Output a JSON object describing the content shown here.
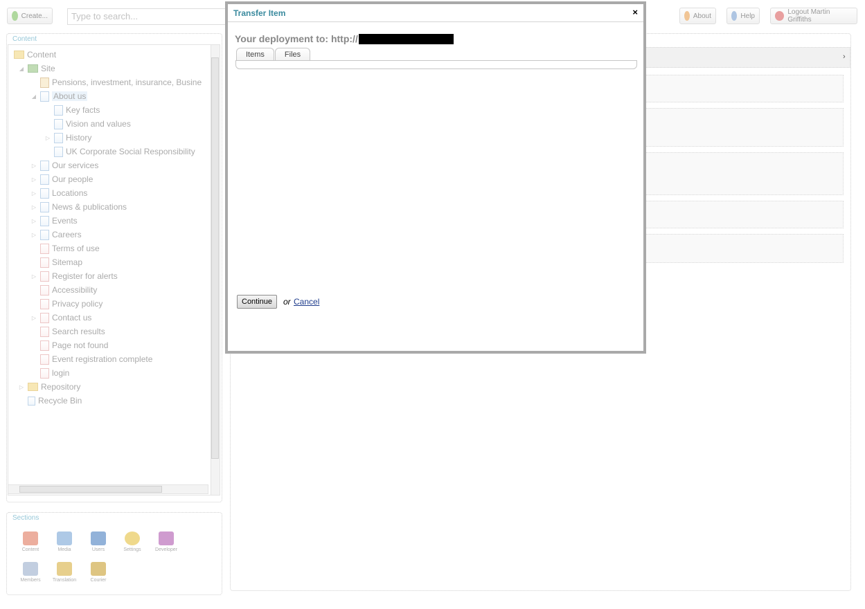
{
  "topbar": {
    "create_label": "Create...",
    "search_placeholder": "Type to search...",
    "about_label": "About",
    "help_label": "Help",
    "logout_label": "Logout  Martin Griffiths"
  },
  "content_panel": {
    "title": "Content",
    "tree": [
      {
        "label": "Content"
      },
      {
        "label": "Site"
      },
      {
        "label": "Pensions, investment, insurance, Busine"
      },
      {
        "label": "About us"
      },
      {
        "label": "Key facts"
      },
      {
        "label": "Vision and values"
      },
      {
        "label": "History"
      },
      {
        "label": "UK Corporate Social Responsibility"
      },
      {
        "label": "Our services"
      },
      {
        "label": "Our people"
      },
      {
        "label": "Locations"
      },
      {
        "label": "News & publications"
      },
      {
        "label": "Events"
      },
      {
        "label": "Careers"
      },
      {
        "label": "Terms of use"
      },
      {
        "label": "Sitemap"
      },
      {
        "label": "Register for alerts"
      },
      {
        "label": "Accessibility"
      },
      {
        "label": "Privacy policy"
      },
      {
        "label": "Contact us"
      },
      {
        "label": "Search results"
      },
      {
        "label": "Page not found"
      },
      {
        "label": "Event registration complete"
      },
      {
        "label": "login"
      },
      {
        "label": "Repository"
      },
      {
        "label": "Recycle Bin"
      }
    ]
  },
  "sections_panel": {
    "title": "Sections",
    "items": [
      {
        "label": "Content",
        "color": "#e07a5f"
      },
      {
        "label": "Media",
        "color": "#7aa6d6"
      },
      {
        "label": "Users",
        "color": "#4a7fc0"
      },
      {
        "label": "Settings",
        "color": "#e6c040"
      },
      {
        "label": "Developer",
        "color": "#b05ab0"
      },
      {
        "label": "Members",
        "color": "#9aaecc"
      },
      {
        "label": "Translation",
        "color": "#d8b040"
      },
      {
        "label": "Courier",
        "color": "#c9a030"
      }
    ]
  },
  "modal": {
    "title": "Transfer Item",
    "close_label": "×",
    "deployment_text": "Your deployment to: http://",
    "tabs": [
      {
        "label": "Items"
      },
      {
        "label": "Files"
      }
    ],
    "continue_label": "Continue",
    "or_text": "or",
    "cancel_label": "Cancel"
  },
  "colors": {
    "accent": "#3a8a9e",
    "link": "#1e3c8c"
  }
}
